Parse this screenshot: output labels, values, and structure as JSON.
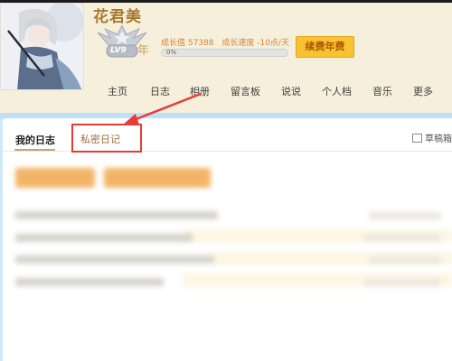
{
  "profile": {
    "nickname": "花君美",
    "level": "LV9",
    "year_label": "年",
    "growth_value": "成长值 57388",
    "growth_speed": "成长速度 -10点/天",
    "progress_fraction": 0,
    "progress_text": "0%",
    "renew_button": "续费年费"
  },
  "nav": {
    "items": [
      "主页",
      "日志",
      "相册",
      "留言板",
      "说说",
      "个人档",
      "音乐",
      "更多"
    ]
  },
  "diary": {
    "tab_my": "我的日志",
    "tab_private": "私密日记",
    "drafts": "草稿箱"
  },
  "colors": {
    "accent_gold": "#f8c232",
    "highlight_red": "#e73c36",
    "header_bg": "#f6efdc",
    "band_blue": "#bfe1f6"
  }
}
